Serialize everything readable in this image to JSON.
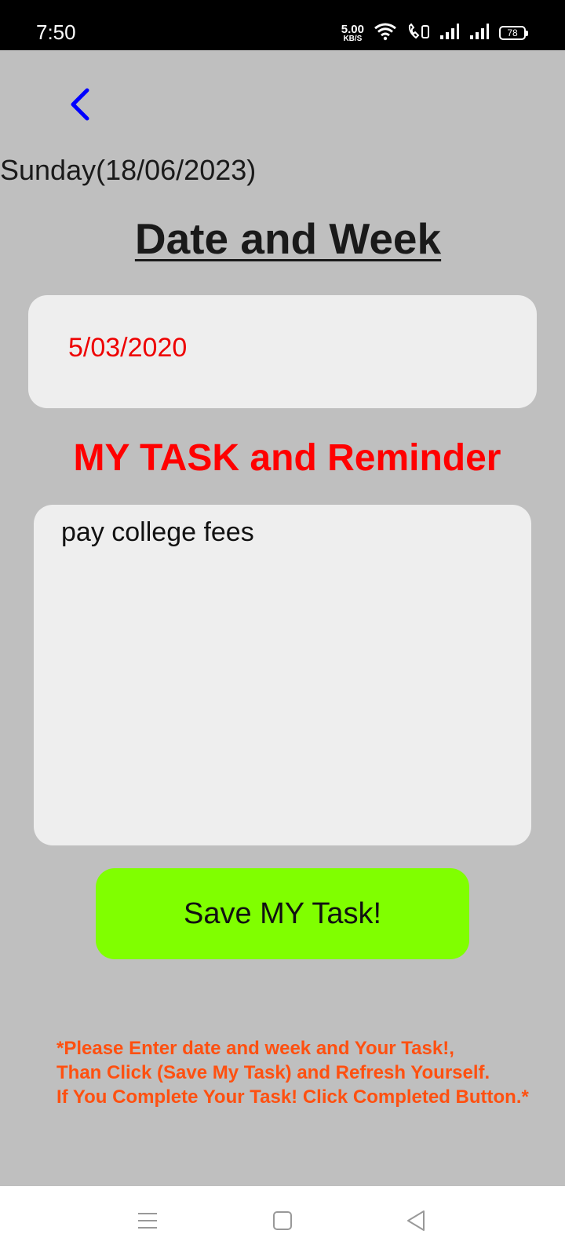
{
  "status_bar": {
    "time": "7:50",
    "net_speed_value": "5.00",
    "net_speed_unit": "KB/S",
    "battery": "78",
    "icons": [
      "wifi-icon",
      "call-icon",
      "signal-icon",
      "signal-icon",
      "battery-icon"
    ]
  },
  "header": {
    "back_icon": "chevron-left-icon",
    "back_color": "#0000ff",
    "date_label": "Sunday(18/06/2023)",
    "title": "Date and Week"
  },
  "date_field": {
    "value": "5/03/2020",
    "text_color": "#ee0000"
  },
  "task_section": {
    "heading": "MY TASK and Reminder",
    "heading_color": "#ff0000",
    "task_value": "pay college fees"
  },
  "save_button": {
    "label": "Save MY Task!",
    "color": "#80ff00"
  },
  "instructions": {
    "lines": [
      "*Please Enter date and week and Your Task!,",
      "Than Click (Save My Task) and Refresh Yourself.",
      "If You Complete Your Task! Click Completed Button.*"
    ],
    "color": "#ff5010"
  },
  "nav_bar": {
    "buttons": [
      "menu-icon",
      "home-icon",
      "back-icon"
    ]
  },
  "colors": {
    "background": "#bfbfbf",
    "field_background": "#eeeeee"
  }
}
